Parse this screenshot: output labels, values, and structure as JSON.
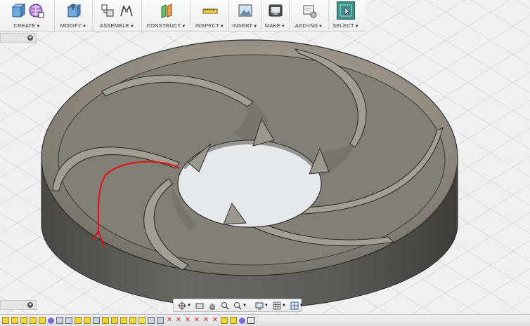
{
  "toolbar": {
    "groups": [
      {
        "label": "CREATE",
        "icons": [
          "extrude-icon",
          "pattern-grid-icon"
        ]
      },
      {
        "label": "MODIFY",
        "icons": [
          "press-pull-icon"
        ]
      },
      {
        "label": "ASSEMBLE",
        "icons": [
          "new-component-icon",
          "joint-icon"
        ]
      },
      {
        "label": "CONSTRUCT",
        "icons": [
          "offset-plane-icon"
        ]
      },
      {
        "label": "INSPECT",
        "icons": [
          "measure-icon"
        ]
      },
      {
        "label": "INSERT",
        "icons": [
          "insert-image-icon"
        ]
      },
      {
        "label": "MAKE",
        "icons": [
          "3d-print-icon"
        ]
      },
      {
        "label": "ADD-INS",
        "icons": [
          "scripts-icon"
        ]
      },
      {
        "label": "SELECT",
        "icons": [
          "select-arrow-icon"
        ]
      }
    ]
  },
  "browser_panel": {
    "toggle": "●"
  },
  "comments_panel": {
    "toggle": "●"
  },
  "navbar": {
    "icons": [
      "orbit-icon",
      "look-at-icon",
      "pan-icon",
      "zoom-window-icon",
      "zoom-icon",
      "display-settings-icon",
      "grid-settings-icon",
      "viewports-icon"
    ]
  },
  "viewport": {
    "model": "impeller-disc",
    "colors": {
      "body": "#8a857c",
      "side": "#5a5853",
      "grid": "#b9c0c6",
      "sketch": "#e01010"
    }
  }
}
